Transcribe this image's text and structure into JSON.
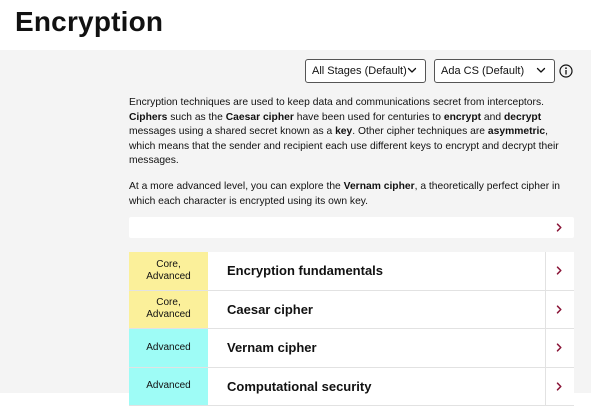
{
  "page": {
    "title": "Encryption"
  },
  "filters": {
    "stages_value": "All Stages (Default)",
    "board_value": "Ada CS (Default)"
  },
  "intro": {
    "p1": [
      {
        "t": "Encryption techniques are used to keep data and communications secret from interceptors. ",
        "b": false
      },
      {
        "t": "Ciphers",
        "b": true
      },
      {
        "t": " such as the ",
        "b": false
      },
      {
        "t": "Caesar cipher",
        "b": true
      },
      {
        "t": " have been used for centuries to ",
        "b": false
      },
      {
        "t": "encrypt",
        "b": true
      },
      {
        "t": " and ",
        "b": false
      },
      {
        "t": "decrypt",
        "b": true
      },
      {
        "t": " messages using a shared secret known as a ",
        "b": false
      },
      {
        "t": "key",
        "b": true
      },
      {
        "t": ". Other cipher techniques are ",
        "b": false
      },
      {
        "t": "asymmetric",
        "b": true
      },
      {
        "t": ", which means that the sender and recipient each use different keys to encrypt and decrypt their messages.",
        "b": false
      }
    ],
    "p2": [
      {
        "t": "At a more advanced level, you can explore the ",
        "b": false
      },
      {
        "t": "Vernam cipher",
        "b": true
      },
      {
        "t": ", a theoretically perfect cipher in which each character is encrypted using its own key.",
        "b": false
      }
    ]
  },
  "topics": [
    {
      "tag": "Core,\nAdvanced",
      "title": "Encryption fundamentals",
      "tag_color": "#fbf09a"
    },
    {
      "tag": "Core,\nAdvanced",
      "title": "Caesar cipher",
      "tag_color": "#fbf09a"
    },
    {
      "tag": "Advanced",
      "title": "Vernam cipher",
      "tag_color": "#9efcf6"
    },
    {
      "tag": "Advanced",
      "title": "Computational security",
      "tag_color": "#9efcf6"
    }
  ],
  "colors": {
    "accent": "#8a1538",
    "core_tag": "#fbf09a",
    "advanced_tag": "#9efcf6",
    "background": "#f4f4f4"
  },
  "icons": {
    "dropdown": "chevron-down-icon",
    "info": "info-icon",
    "row": "chevron-right-icon"
  }
}
